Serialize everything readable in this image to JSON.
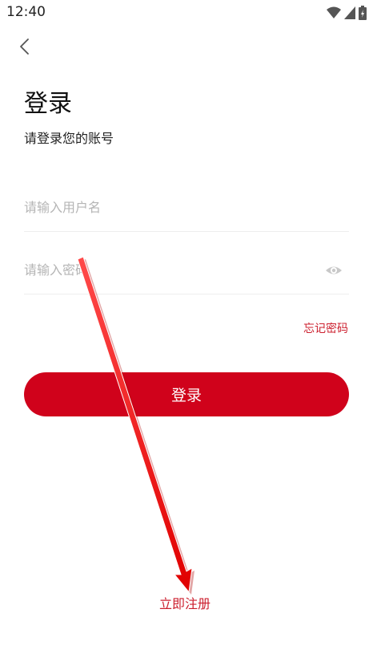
{
  "status_bar": {
    "time": "12:40"
  },
  "header": {
    "back_icon": "chevron-left-icon",
    "title": "登录",
    "subtitle": "请登录您的账号"
  },
  "form": {
    "username": {
      "value": "",
      "placeholder": "请输入用户名"
    },
    "password": {
      "value": "",
      "placeholder": "请输入密码",
      "toggle_icon": "eye-icon"
    },
    "forgot_label": "忘记密码",
    "login_label": "登录"
  },
  "footer": {
    "register_label": "立即注册"
  },
  "colors": {
    "accent": "#d0021b",
    "link": "#cc1f2e",
    "placeholder": "#b5b5b5",
    "divider": "#eeeeee"
  }
}
